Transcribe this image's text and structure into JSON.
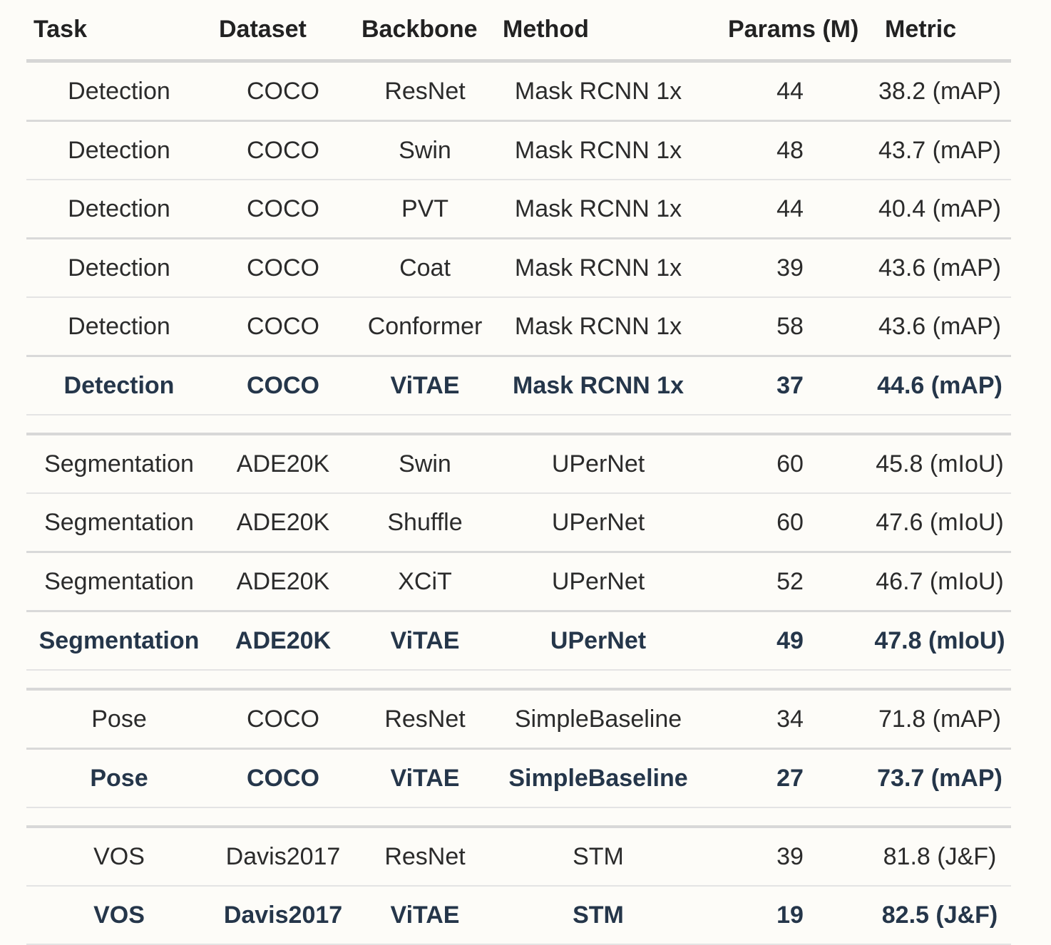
{
  "table": {
    "headers": {
      "task": "Task",
      "dataset": "Dataset",
      "backbone": "Backbone",
      "method": "Method",
      "params": "Params (M)",
      "metric": "Metric"
    },
    "groups": [
      {
        "rows": [
          {
            "task": "Detection",
            "dataset": "COCO",
            "backbone": "ResNet",
            "method": "Mask RCNN 1x",
            "params": "44",
            "metric": "38.2 (mAP)",
            "best": false
          },
          {
            "task": "Detection",
            "dataset": "COCO",
            "backbone": "Swin",
            "method": "Mask RCNN 1x",
            "params": "48",
            "metric": "43.7 (mAP)",
            "best": false
          },
          {
            "task": "Detection",
            "dataset": "COCO",
            "backbone": "PVT",
            "method": "Mask RCNN 1x",
            "params": "44",
            "metric": "40.4 (mAP)",
            "best": false
          },
          {
            "task": "Detection",
            "dataset": "COCO",
            "backbone": "Coat",
            "method": "Mask RCNN 1x",
            "params": "39",
            "metric": "43.6 (mAP)",
            "best": false
          },
          {
            "task": "Detection",
            "dataset": "COCO",
            "backbone": "Conformer",
            "method": "Mask RCNN 1x",
            "params": "58",
            "metric": "43.6 (mAP)",
            "best": false
          },
          {
            "task": "Detection",
            "dataset": "COCO",
            "backbone": "ViTAE",
            "method": "Mask RCNN 1x",
            "params": "37",
            "metric": "44.6 (mAP)",
            "best": true
          }
        ]
      },
      {
        "rows": [
          {
            "task": "Segmentation",
            "dataset": "ADE20K",
            "backbone": "Swin",
            "method": "UPerNet",
            "params": "60",
            "metric": "45.8 (mIoU)",
            "best": false
          },
          {
            "task": "Segmentation",
            "dataset": "ADE20K",
            "backbone": "Shuffle",
            "method": "UPerNet",
            "params": "60",
            "metric": "47.6 (mIoU)",
            "best": false
          },
          {
            "task": "Segmentation",
            "dataset": "ADE20K",
            "backbone": "XCiT",
            "method": "UPerNet",
            "params": "52",
            "metric": "46.7 (mIoU)",
            "best": false
          },
          {
            "task": "Segmentation",
            "dataset": "ADE20K",
            "backbone": "ViTAE",
            "method": "UPerNet",
            "params": "49",
            "metric": "47.8 (mIoU)",
            "best": true
          }
        ]
      },
      {
        "rows": [
          {
            "task": "Pose",
            "dataset": "COCO",
            "backbone": "ResNet",
            "method": "SimpleBaseline",
            "params": "34",
            "metric": "71.8 (mAP)",
            "best": false
          },
          {
            "task": "Pose",
            "dataset": "COCO",
            "backbone": "ViTAE",
            "method": "SimpleBaseline",
            "params": "27",
            "metric": "73.7 (mAP)",
            "best": true
          }
        ]
      },
      {
        "rows": [
          {
            "task": "VOS",
            "dataset": "Davis2017",
            "backbone": "ResNet",
            "method": "STM",
            "params": "39",
            "metric": "81.8 (J&F)",
            "best": false
          },
          {
            "task": "VOS",
            "dataset": "Davis2017",
            "backbone": "ViTAE",
            "method": "STM",
            "params": "19",
            "metric": "82.5 (J&F)",
            "best": true
          }
        ]
      }
    ]
  },
  "colors": {
    "background": "#fdfcf8",
    "text": "#2b2b2b",
    "highlight_text": "#25364a",
    "rule": "#d6d6d6"
  }
}
